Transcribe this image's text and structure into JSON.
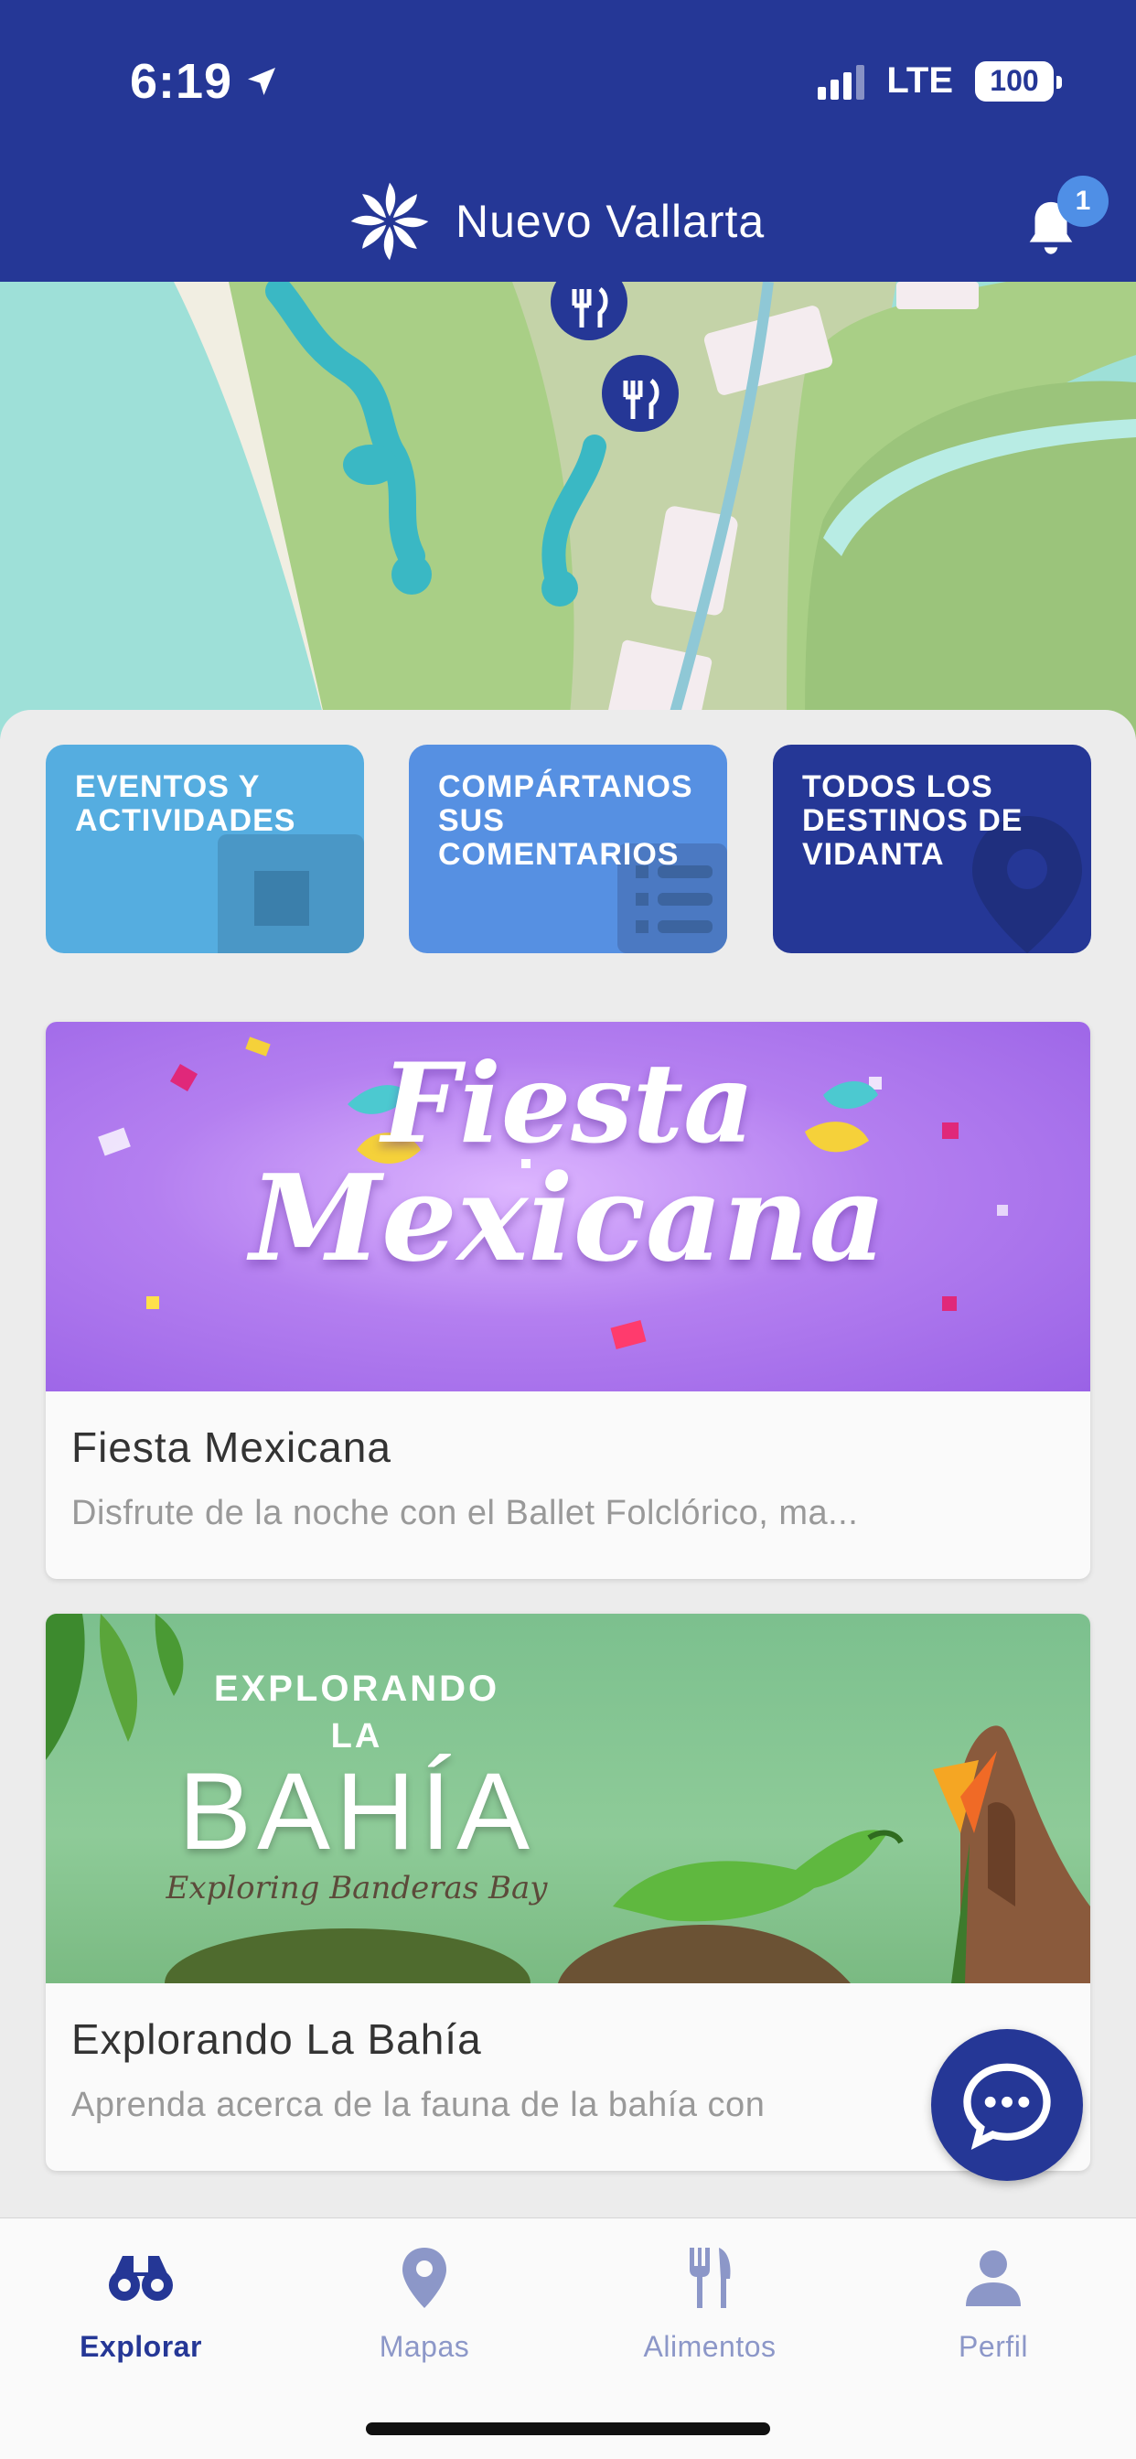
{
  "status_bar": {
    "time": "6:19",
    "network": "LTE",
    "battery": "100"
  },
  "header": {
    "title": "Nuevo Vallarta",
    "notification_count": "1"
  },
  "quick_tiles": [
    {
      "label": "EVENTOS Y ACTIVIDADES",
      "color": "#55ade0"
    },
    {
      "label": "COMPÁRTANOS SUS COMENTARIOS",
      "color": "#5690e2"
    },
    {
      "label": "TODOS LOS DESTINOS DE VIDANTA",
      "color": "#253796"
    }
  ],
  "cards": [
    {
      "title": "Fiesta Mexicana",
      "subtitle": "Disfrute de la noche con el Ballet Folclórico, ma...",
      "image_text": [
        "Fiesta",
        "Mexicana"
      ]
    },
    {
      "title": "Explorando La Bahía",
      "subtitle": "Aprenda acerca de la fauna de la bahía con",
      "image_text": [
        "EXPLORANDO",
        "LA",
        "BAHÍA",
        "Exploring Banderas Bay"
      ]
    }
  ],
  "tabs": [
    {
      "label": "Explorar",
      "icon": "binoculars-icon",
      "active": true
    },
    {
      "label": "Mapas",
      "icon": "map-pin-icon",
      "active": false
    },
    {
      "label": "Alimentos",
      "icon": "fork-knife-icon",
      "active": false
    },
    {
      "label": "Perfil",
      "icon": "user-icon",
      "active": false
    }
  ],
  "colors": {
    "brand": "#253796",
    "accent": "#4f8fe6"
  }
}
